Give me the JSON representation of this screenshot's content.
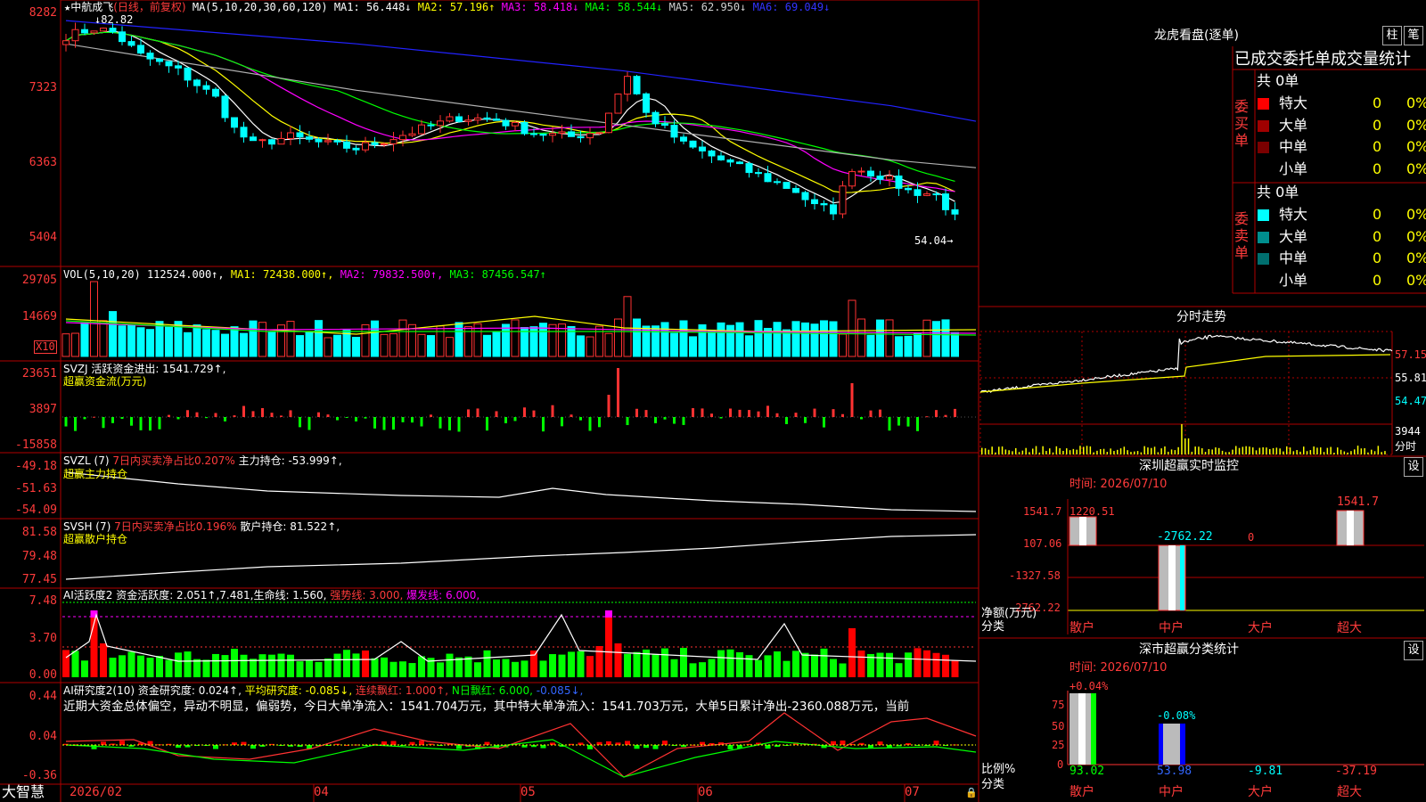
{
  "stock": {
    "star": "★",
    "name": "中航成飞",
    "mode": "(日线，前复权)",
    "ma_param": "MA(5,10,20,30,60,120)",
    "ma1_label": "MA1:",
    "ma1": "56.448↓",
    "ma2_label": "MA2:",
    "ma2": "57.196↑",
    "ma3_label": "MA3:",
    "ma3": "58.418↓",
    "ma4_label": "MA4:",
    "ma4": "58.544↓",
    "ma5_label": "MA5:",
    "ma5": "62.950↓",
    "ma6_label": "MA6:",
    "ma6": "69.049↓",
    "high_mark": "82.82",
    "low_mark": "54.04→",
    "y_axis": [
      "8282",
      "7323",
      "6363",
      "5404"
    ]
  },
  "vol": {
    "line": "VOL(5,10,20)",
    "value": "112524.000↑,",
    "ma1": "MA1: 72438.000↑,",
    "ma2": "MA2: 79832.500↑,",
    "ma3": "MA3: 87456.547↑",
    "y_axis": [
      "29705",
      "14669"
    ],
    "unit": "X10"
  },
  "svzj": {
    "line1": "SVZJ  活跃资金进出: 1541.729↑,",
    "line2": "超赢资金流(万元)",
    "y_axis": [
      "23651",
      "3897",
      "-15858"
    ]
  },
  "svzl": {
    "code": "SVZL (7)",
    "ratio": "7日内买卖净占比0.207%",
    "hold": "主力持仓: -53.999↑,",
    "line2": "超赢主力持仓",
    "y_axis": [
      "-49.18",
      "-51.63",
      "-54.09"
    ]
  },
  "svsh": {
    "code": "SVSH (7)",
    "ratio": "7日内买卖净占比0.196%",
    "hold": "散户持仓: 81.522↑,",
    "line2": "超赢散户持仓",
    "y_axis": [
      "81.58",
      "79.48",
      "77.45"
    ]
  },
  "ai1": {
    "title": "AI活跃度2 资金活跃度: 2.051↑,7.481,生命线: 1.560,",
    "strong": "强势线: 3.000,",
    "burst": "爆发线: 6.000,",
    "y_axis": [
      "7.48",
      "3.70",
      "0.00"
    ]
  },
  "ai2": {
    "title": "AI研究度2(10) 资金研究度: 0.024↑,",
    "avg": "平均研究度: -0.085↓,",
    "cont": "连续飘红: 1.000↑,",
    "nday": "N日飘红: 6.000,",
    "neg": "-0.085↓,",
    "comment": "近期大资金总体偏空，异动不明显，偏弱势，今日大单净流入：1541.704万元，其中特大单净流入：1541.703万元，大单5日累计净出-2360.088万元，当前",
    "y_axis": [
      "0.44",
      "0.04",
      "-0.36"
    ]
  },
  "xaxis": {
    "brand": "大智慧",
    "labels": [
      "2026/02",
      "04",
      "05",
      "06",
      "07"
    ]
  },
  "right": {
    "lhb_title": "龙虎看盘(逐单)",
    "btn_zhu": "柱",
    "btn_bi": "笔",
    "tabs": "已成交委托单成交量统计",
    "buy_side": "委买单",
    "sell_side": "委卖单",
    "buy_total": "共 0单",
    "sell_total": "共 0单",
    "buy_rows": [
      {
        "name": "特大",
        "val": "0",
        "pct": "0%"
      },
      {
        "name": "大单",
        "val": "0",
        "pct": "0%"
      },
      {
        "name": "中单",
        "val": "0",
        "pct": "0%"
      },
      {
        "name": "小单",
        "val": "0",
        "pct": "0%"
      }
    ],
    "sell_rows": [
      {
        "name": "特大",
        "val": "0",
        "pct": "0%"
      },
      {
        "name": "大单",
        "val": "0",
        "pct": "0%"
      },
      {
        "name": "中单",
        "val": "0",
        "pct": "0%"
      },
      {
        "name": "小单",
        "val": "0",
        "pct": "0%"
      }
    ],
    "fs_title": "分时走势",
    "fs_y": [
      "57.15",
      "55.81",
      "54.47"
    ],
    "fs_vol": "3944",
    "fs_tag": "分时",
    "mon_title": "深圳超赢实时监控",
    "mon_btn": "设",
    "mon_time": "时间: 2026/07/10",
    "mon_y": [
      "1541.7",
      "107.06",
      "-1327.58",
      "-2762.22"
    ],
    "mon_vals": [
      "1220.51",
      "-2762.22",
      "0",
      "1541.7"
    ],
    "mon_ylabel": "净额(万元)",
    "mon_xlabel": "分类",
    "cats": [
      "散户",
      "中户",
      "大户",
      "超大"
    ],
    "stat_title": "深市超赢分类统计",
    "stat_btn": "设",
    "stat_time": "时间: 2026/07/10",
    "stat_y": [
      "75",
      "50",
      "25",
      "0"
    ],
    "stat_top": [
      "+0.04%",
      "-0.08%"
    ],
    "stat_bottom": [
      "93.02",
      "53.98",
      "-9.81",
      "-37.19"
    ],
    "stat_ylabel": "比例%",
    "stat_xlabel": "分类"
  },
  "colors": {
    "up": "#ff3232",
    "down": "#00ffff",
    "grid": "#b00000",
    "ma1": "#ffffff",
    "ma2": "#ffff00",
    "ma3": "#ff00ff",
    "ma4": "#00ff00",
    "ma5": "#b0b0b0",
    "ma6": "#2222ff"
  }
}
